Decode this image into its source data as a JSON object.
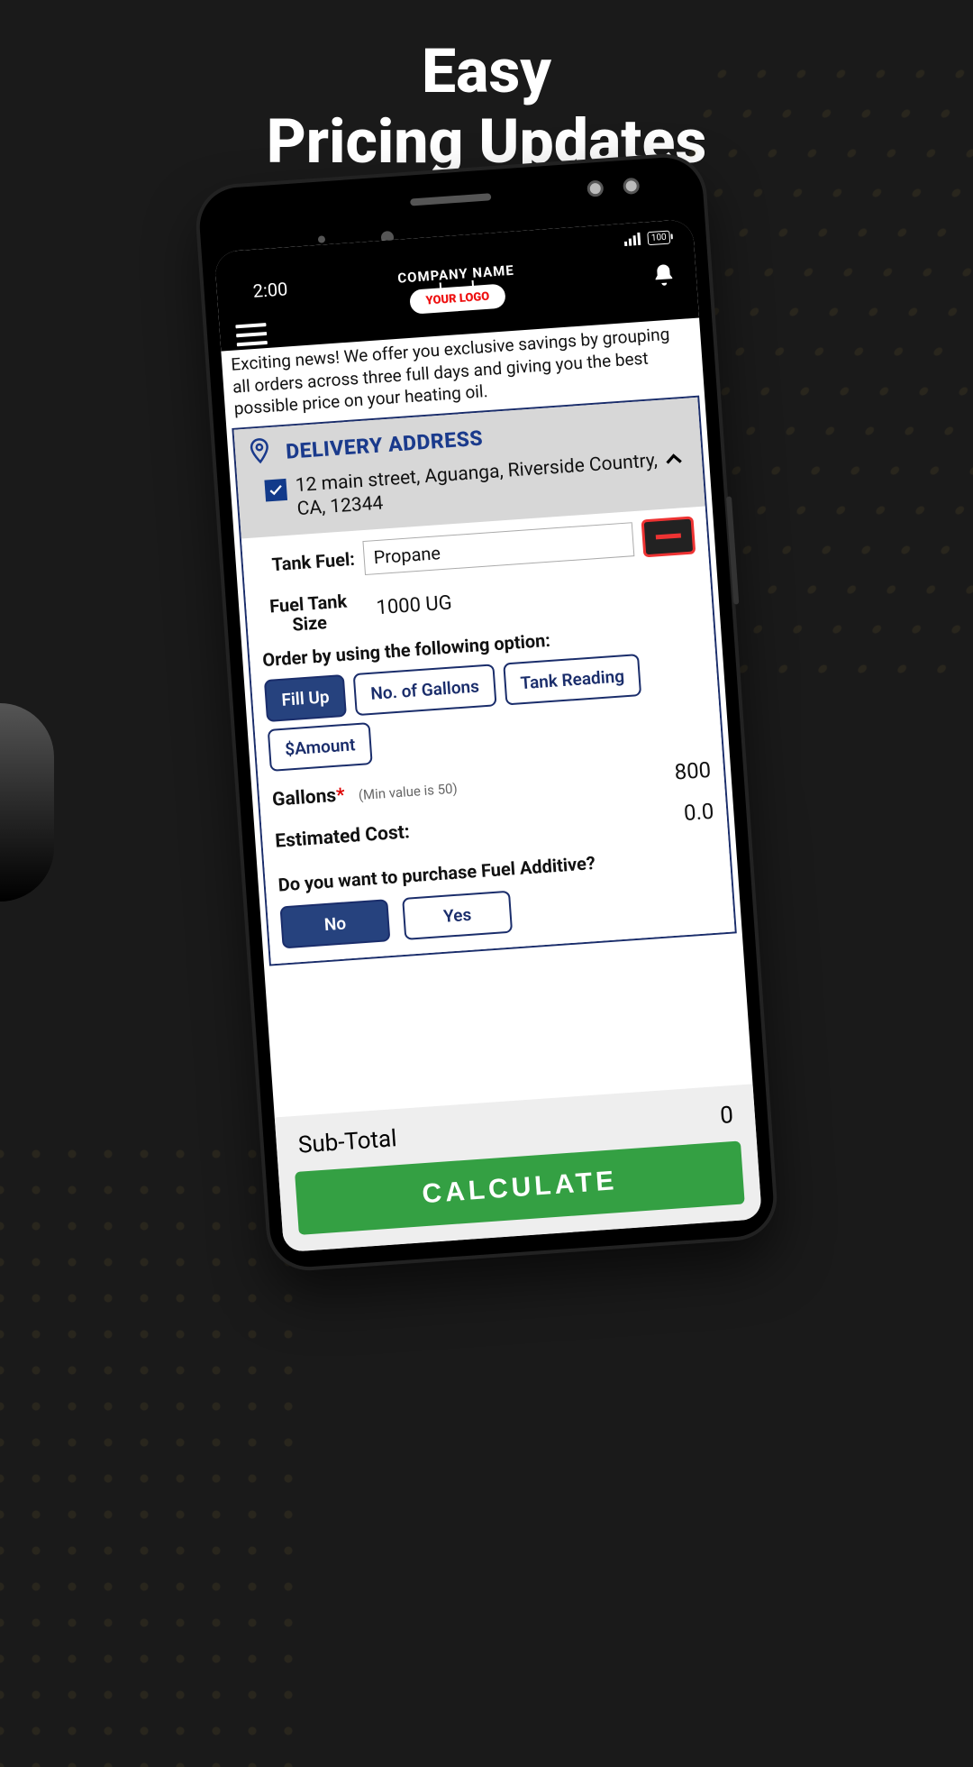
{
  "promo": {
    "line1": "Easy",
    "line2": "Pricing Updates"
  },
  "status": {
    "time": "2:00",
    "battery": "100"
  },
  "header": {
    "company": "COMPANY NAME",
    "logo_text": "YOUR LOGO"
  },
  "banner": "Exciting news! We offer you exclusive savings by grouping all orders across three full days and giving you the best possible price on your heating oil.",
  "delivery": {
    "title": "DELIVERY ADDRESS",
    "address": "12 main street, Aguanga, Riverside Country, CA, 12344",
    "checked": true
  },
  "fuel": {
    "tank_fuel_label": "Tank Fuel:",
    "tank_fuel_value": "Propane",
    "tank_size_label": "Fuel Tank Size",
    "tank_size_value": "1000 UG"
  },
  "order": {
    "option_title": "Order by using the following option:",
    "options": [
      "Fill Up",
      "No. of Gallons",
      "Tank Reading",
      "$Amount"
    ],
    "selected_index": 0
  },
  "gallons": {
    "label": "Gallons",
    "hint": "(Min value is 50)",
    "value": "800"
  },
  "estimated": {
    "label": "Estimated Cost:",
    "value": "0.0"
  },
  "additive": {
    "question": "Do you want to purchase Fuel Additive?",
    "no": "No",
    "yes": "Yes",
    "selected": "No"
  },
  "footer": {
    "subtotal_label": "Sub-Total",
    "subtotal_value": "0",
    "calculate": "CALCULATE"
  }
}
